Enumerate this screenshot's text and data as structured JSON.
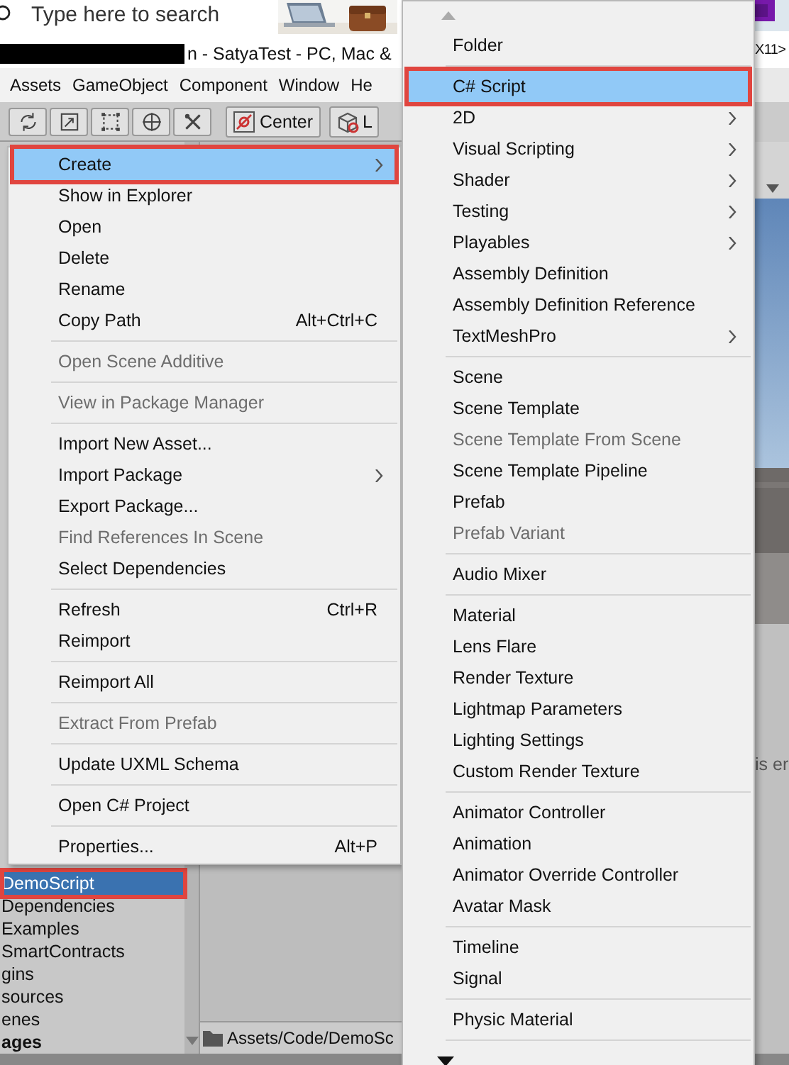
{
  "taskbar_search": {
    "placeholder": "Type here to search"
  },
  "window": {
    "title": "n - SatyaTest - PC, Mac &",
    "title_right": "X11>"
  },
  "menu_bar": [
    "Assets",
    "GameObject",
    "Component",
    "Window",
    "He"
  ],
  "toolbar": {
    "buttons": [
      {
        "label": "Center"
      },
      {
        "label": "L"
      }
    ]
  },
  "project_tree": {
    "items": [
      {
        "kind": "item",
        "label": "DemoScript",
        "selected": true,
        "highlighted": true
      },
      {
        "kind": "item",
        "label": "Dependencies",
        "selected": false,
        "highlighted": false
      },
      {
        "kind": "item",
        "label": "Examples",
        "selected": false,
        "highlighted": false
      },
      {
        "kind": "item",
        "label": "SmartContracts",
        "selected": false,
        "highlighted": false
      },
      {
        "kind": "item",
        "label": "gins",
        "selected": false,
        "highlighted": false
      },
      {
        "kind": "item",
        "label": "sources",
        "selected": false,
        "highlighted": false
      },
      {
        "kind": "item",
        "label": "enes",
        "selected": false,
        "highlighted": false
      },
      {
        "kind": "header",
        "label": "ages",
        "selected": false,
        "highlighted": false
      }
    ]
  },
  "path_bar": {
    "path": "Assets/Code/DemoSc"
  },
  "scene_panel": {
    "text": "is er"
  },
  "context_menu": {
    "items": [
      {
        "kind": "item",
        "label": "Create",
        "submenu": true,
        "selected": true,
        "highlighted": true,
        "disabled": false
      },
      {
        "kind": "item",
        "label": "Show in Explorer",
        "submenu": false,
        "selected": false,
        "highlighted": false,
        "disabled": false
      },
      {
        "kind": "item",
        "label": "Open",
        "submenu": false,
        "selected": false,
        "highlighted": false,
        "disabled": false
      },
      {
        "kind": "item",
        "label": "Delete",
        "submenu": false,
        "selected": false,
        "highlighted": false,
        "disabled": false
      },
      {
        "kind": "item",
        "label": "Rename",
        "submenu": false,
        "selected": false,
        "highlighted": false,
        "disabled": false
      },
      {
        "kind": "item",
        "label": "Copy Path",
        "shortcut": "Alt+Ctrl+C",
        "submenu": false,
        "selected": false,
        "highlighted": false,
        "disabled": false
      },
      {
        "kind": "separator"
      },
      {
        "kind": "item",
        "label": "Open Scene Additive",
        "submenu": false,
        "selected": false,
        "highlighted": false,
        "disabled": true
      },
      {
        "kind": "separator"
      },
      {
        "kind": "item",
        "label": "View in Package Manager",
        "submenu": false,
        "selected": false,
        "highlighted": false,
        "disabled": true
      },
      {
        "kind": "separator"
      },
      {
        "kind": "item",
        "label": "Import New Asset...",
        "submenu": false,
        "selected": false,
        "highlighted": false,
        "disabled": false
      },
      {
        "kind": "item",
        "label": "Import Package",
        "submenu": true,
        "selected": false,
        "highlighted": false,
        "disabled": false
      },
      {
        "kind": "item",
        "label": "Export Package...",
        "submenu": false,
        "selected": false,
        "highlighted": false,
        "disabled": false
      },
      {
        "kind": "item",
        "label": "Find References In Scene",
        "submenu": false,
        "selected": false,
        "highlighted": false,
        "disabled": true
      },
      {
        "kind": "item",
        "label": "Select Dependencies",
        "submenu": false,
        "selected": false,
        "highlighted": false,
        "disabled": false
      },
      {
        "kind": "separator"
      },
      {
        "kind": "item",
        "label": "Refresh",
        "shortcut": "Ctrl+R",
        "submenu": false,
        "selected": false,
        "highlighted": false,
        "disabled": false
      },
      {
        "kind": "item",
        "label": "Reimport",
        "submenu": false,
        "selected": false,
        "highlighted": false,
        "disabled": false
      },
      {
        "kind": "separator"
      },
      {
        "kind": "item",
        "label": "Reimport All",
        "submenu": false,
        "selected": false,
        "highlighted": false,
        "disabled": false
      },
      {
        "kind": "separator"
      },
      {
        "kind": "item",
        "label": "Extract From Prefab",
        "submenu": false,
        "selected": false,
        "highlighted": false,
        "disabled": true
      },
      {
        "kind": "separator"
      },
      {
        "kind": "item",
        "label": "Update UXML Schema",
        "submenu": false,
        "selected": false,
        "highlighted": false,
        "disabled": false
      },
      {
        "kind": "separator"
      },
      {
        "kind": "item",
        "label": "Open C# Project",
        "submenu": false,
        "selected": false,
        "highlighted": false,
        "disabled": false
      },
      {
        "kind": "separator"
      },
      {
        "kind": "item",
        "label": "Properties...",
        "shortcut": "Alt+P",
        "submenu": false,
        "selected": false,
        "highlighted": false,
        "disabled": false
      }
    ]
  },
  "create_submenu": {
    "items": [
      {
        "kind": "item",
        "label": "Folder",
        "submenu": false,
        "selected": false,
        "highlighted": false,
        "disabled": false
      },
      {
        "kind": "separator"
      },
      {
        "kind": "item",
        "label": "C# Script",
        "submenu": false,
        "selected": true,
        "highlighted": true,
        "disabled": false
      },
      {
        "kind": "item",
        "label": "2D",
        "submenu": true,
        "selected": false,
        "highlighted": false,
        "disabled": false
      },
      {
        "kind": "item",
        "label": "Visual Scripting",
        "submenu": true,
        "selected": false,
        "highlighted": false,
        "disabled": false
      },
      {
        "kind": "item",
        "label": "Shader",
        "submenu": true,
        "selected": false,
        "highlighted": false,
        "disabled": false
      },
      {
        "kind": "item",
        "label": "Testing",
        "submenu": true,
        "selected": false,
        "highlighted": false,
        "disabled": false
      },
      {
        "kind": "item",
        "label": "Playables",
        "submenu": true,
        "selected": false,
        "highlighted": false,
        "disabled": false
      },
      {
        "kind": "item",
        "label": "Assembly Definition",
        "submenu": false,
        "selected": false,
        "highlighted": false,
        "disabled": false
      },
      {
        "kind": "item",
        "label": "Assembly Definition Reference",
        "submenu": false,
        "selected": false,
        "highlighted": false,
        "disabled": false
      },
      {
        "kind": "item",
        "label": "TextMeshPro",
        "submenu": true,
        "selected": false,
        "highlighted": false,
        "disabled": false
      },
      {
        "kind": "separator"
      },
      {
        "kind": "item",
        "label": "Scene",
        "submenu": false,
        "selected": false,
        "highlighted": false,
        "disabled": false
      },
      {
        "kind": "item",
        "label": "Scene Template",
        "submenu": false,
        "selected": false,
        "highlighted": false,
        "disabled": false
      },
      {
        "kind": "item",
        "label": "Scene Template From Scene",
        "submenu": false,
        "selected": false,
        "highlighted": false,
        "disabled": true
      },
      {
        "kind": "item",
        "label": "Scene Template Pipeline",
        "submenu": false,
        "selected": false,
        "highlighted": false,
        "disabled": false
      },
      {
        "kind": "item",
        "label": "Prefab",
        "submenu": false,
        "selected": false,
        "highlighted": false,
        "disabled": false
      },
      {
        "kind": "item",
        "label": "Prefab Variant",
        "submenu": false,
        "selected": false,
        "highlighted": false,
        "disabled": true
      },
      {
        "kind": "separator"
      },
      {
        "kind": "item",
        "label": "Audio Mixer",
        "submenu": false,
        "selected": false,
        "highlighted": false,
        "disabled": false
      },
      {
        "kind": "separator"
      },
      {
        "kind": "item",
        "label": "Material",
        "submenu": false,
        "selected": false,
        "highlighted": false,
        "disabled": false
      },
      {
        "kind": "item",
        "label": "Lens Flare",
        "submenu": false,
        "selected": false,
        "highlighted": false,
        "disabled": false
      },
      {
        "kind": "item",
        "label": "Render Texture",
        "submenu": false,
        "selected": false,
        "highlighted": false,
        "disabled": false
      },
      {
        "kind": "item",
        "label": "Lightmap Parameters",
        "submenu": false,
        "selected": false,
        "highlighted": false,
        "disabled": false
      },
      {
        "kind": "item",
        "label": "Lighting Settings",
        "submenu": false,
        "selected": false,
        "highlighted": false,
        "disabled": false
      },
      {
        "kind": "item",
        "label": "Custom Render Texture",
        "submenu": false,
        "selected": false,
        "highlighted": false,
        "disabled": false
      },
      {
        "kind": "separator"
      },
      {
        "kind": "item",
        "label": "Animator Controller",
        "submenu": false,
        "selected": false,
        "highlighted": false,
        "disabled": false
      },
      {
        "kind": "item",
        "label": "Animation",
        "submenu": false,
        "selected": false,
        "highlighted": false,
        "disabled": false
      },
      {
        "kind": "item",
        "label": "Animator Override Controller",
        "submenu": false,
        "selected": false,
        "highlighted": false,
        "disabled": false
      },
      {
        "kind": "item",
        "label": "Avatar Mask",
        "submenu": false,
        "selected": false,
        "highlighted": false,
        "disabled": false
      },
      {
        "kind": "separator"
      },
      {
        "kind": "item",
        "label": "Timeline",
        "submenu": false,
        "selected": false,
        "highlighted": false,
        "disabled": false
      },
      {
        "kind": "item",
        "label": "Signal",
        "submenu": false,
        "selected": false,
        "highlighted": false,
        "disabled": false
      },
      {
        "kind": "separator"
      },
      {
        "kind": "item",
        "label": "Physic Material",
        "submenu": false,
        "selected": false,
        "highlighted": false,
        "disabled": false
      },
      {
        "kind": "separator"
      }
    ]
  }
}
